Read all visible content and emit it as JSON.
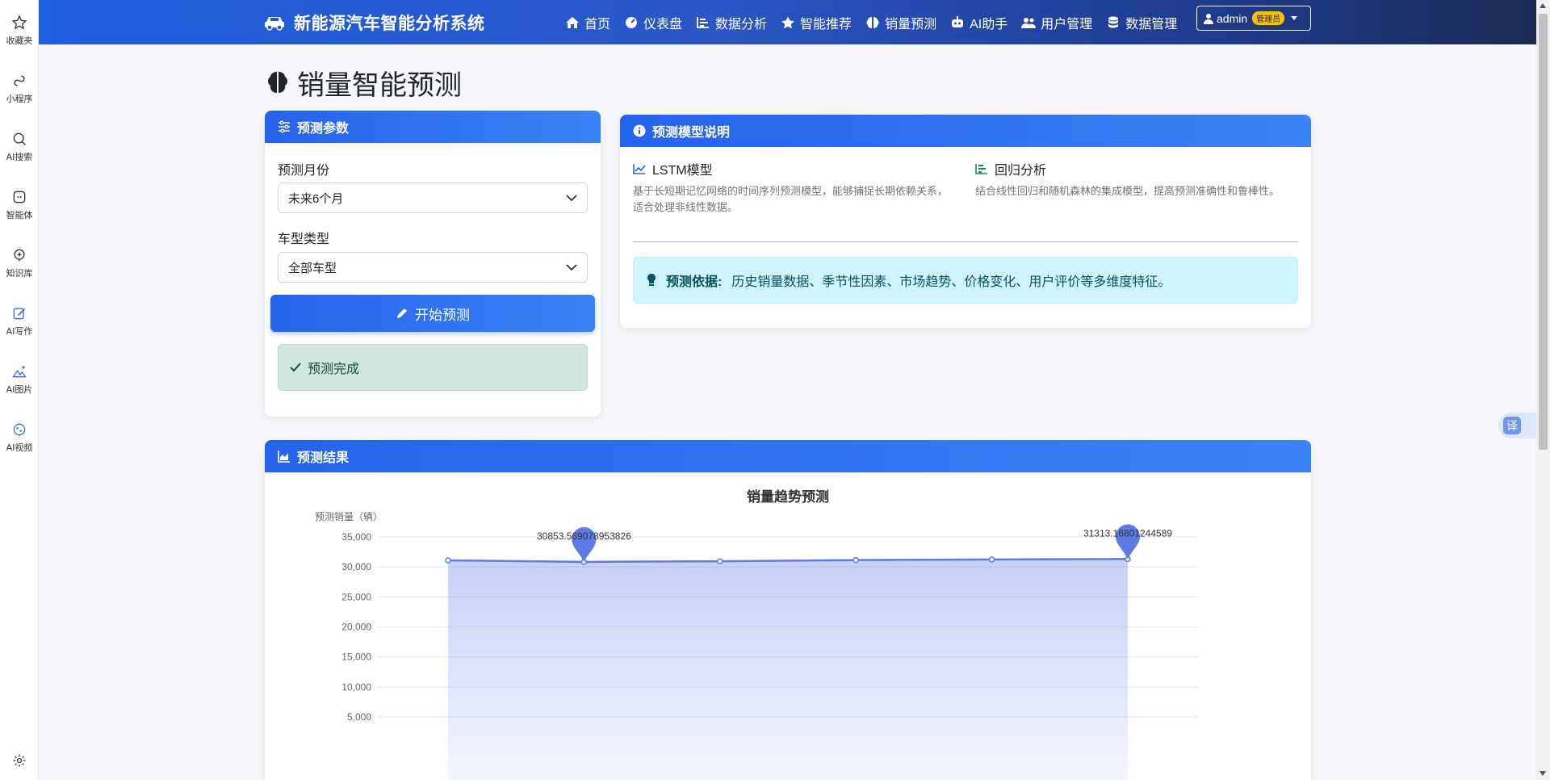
{
  "left_rail": {
    "items": [
      {
        "label": "收藏夹",
        "icon": "star-icon"
      },
      {
        "label": "小程序",
        "icon": "link-icon"
      },
      {
        "label": "AI搜索",
        "icon": "search-icon"
      },
      {
        "label": "智能体",
        "icon": "agent-icon"
      },
      {
        "label": "知识库",
        "icon": "knowledge-icon"
      },
      {
        "label": "AI写作",
        "icon": "write-icon"
      },
      {
        "label": "AI图片",
        "icon": "image-icon"
      },
      {
        "label": "AI视频",
        "icon": "video-icon"
      }
    ],
    "settings_icon": "gear-icon"
  },
  "navbar": {
    "brand": "新能源汽车智能分析系统",
    "brand_icon": "car-icon",
    "items": [
      {
        "label": "首页",
        "icon": "home-icon"
      },
      {
        "label": "仪表盘",
        "icon": "gauge-icon"
      },
      {
        "label": "数据分析",
        "icon": "chart-bar-icon"
      },
      {
        "label": "智能推荐",
        "icon": "star-icon"
      },
      {
        "label": "销量预测",
        "icon": "brain-icon"
      },
      {
        "label": "AI助手",
        "icon": "robot-icon"
      },
      {
        "label": "用户管理",
        "icon": "users-icon"
      },
      {
        "label": "数据管理",
        "icon": "database-icon"
      }
    ],
    "user": {
      "name": "admin",
      "role": "管理员"
    },
    "colors": {
      "start": "#1f5fe0",
      "end": "#1b2b55"
    }
  },
  "page": {
    "title": "销量智能预测",
    "title_icon": "brain-icon"
  },
  "params": {
    "header": "预测参数",
    "month_label": "预测月份",
    "month_value": "未来6个月",
    "type_label": "车型类型",
    "type_value": "全部车型",
    "button": "开始预测",
    "status": "预测完成"
  },
  "model": {
    "header": "预测模型说明",
    "lstm_title": "LSTM模型",
    "lstm_desc": "基于长短期记忆网络的时间序列预测模型，能够捕捉长期依赖关系，适合处理非线性数据。",
    "reg_title": "回归分析",
    "reg_desc": "结合线性回归和随机森林的集成模型，提高预测准确性和鲁棒性。",
    "basis_label": "预测依据:",
    "basis_text": "历史销量数据、季节性因素、市场趋势、价格变化、用户评价等多维度特征。"
  },
  "result": {
    "header": "预测结果"
  },
  "chart_data": {
    "type": "area",
    "title": "销量趋势预测",
    "ylabel": "预测销量（辆）",
    "ylim": [
      0,
      35000
    ],
    "yticks": [
      5000,
      10000,
      15000,
      20000,
      25000,
      30000,
      35000
    ],
    "ytick_labels": [
      "5,000",
      "10,000",
      "15,000",
      "20,000",
      "25,000",
      "30,000",
      "35,000"
    ],
    "values": [
      31100,
      30853.569078953828,
      30950,
      31150,
      31250,
      31313.16801244589
    ],
    "markers": [
      {
        "label": "30853.569078953826",
        "index": 1
      },
      {
        "label": "31313.16801244589",
        "index": 5
      }
    ],
    "grid": true,
    "color": "#5b7be6"
  },
  "floating": {
    "translate_label": "译"
  }
}
